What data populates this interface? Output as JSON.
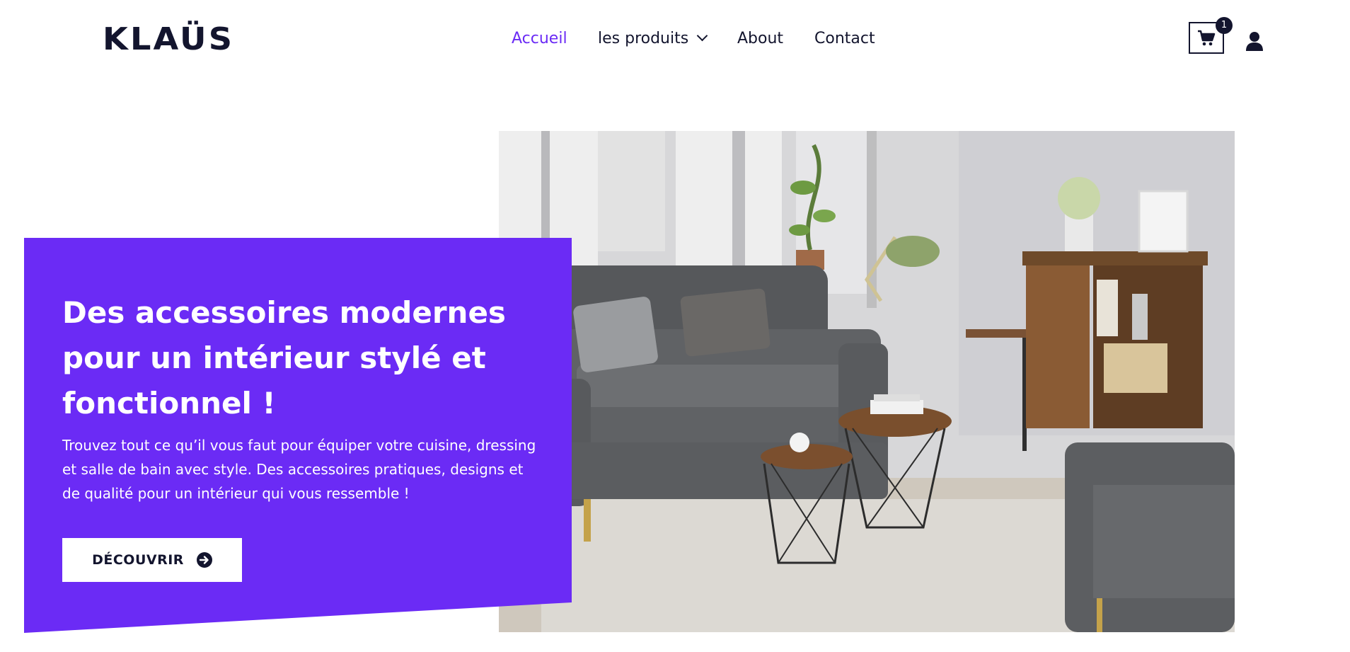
{
  "brand": {
    "logo_text": "KLAÜS"
  },
  "nav": {
    "items": [
      {
        "label": "Accueil",
        "active": true
      },
      {
        "label": "les produits",
        "has_dropdown": true
      },
      {
        "label": "About"
      },
      {
        "label": "Contact"
      }
    ]
  },
  "header_actions": {
    "cart_count": "1",
    "cart_icon": "shopping-cart-icon",
    "user_icon": "user-icon"
  },
  "hero": {
    "title": "Des accessoires modernes pour un intérieur stylé et fonctionnel !",
    "description": "Trouvez tout ce qu’il vous faut pour équiper votre cuisine, dressing et salle de bain avec style. Des accessoires pratiques, designs et de qualité pour un intérieur qui vous ressemble !",
    "cta_label": "DÉCOUVRIR",
    "cta_icon": "arrow-circle-right-icon",
    "image_subject": "living-room-photo"
  },
  "colors": {
    "accent": "#6b2bf5",
    "text_dark": "#13152e",
    "white": "#ffffff"
  }
}
